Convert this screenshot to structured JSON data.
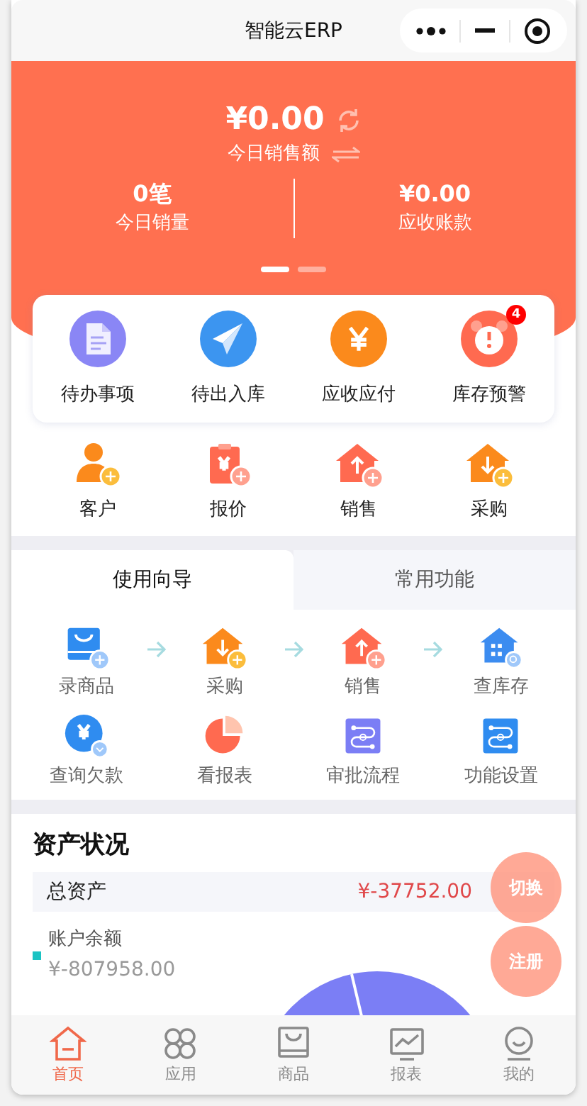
{
  "window": {
    "title": "智能云ERP"
  },
  "summary": {
    "amount": "¥0.00",
    "amount_label": "今日销售额",
    "stats": [
      {
        "value": "0笔",
        "label": "今日销量"
      },
      {
        "value": "¥0.00",
        "label": "应收账款"
      }
    ],
    "pages": [
      {
        "selected": true
      },
      {
        "selected": false
      }
    ]
  },
  "quick": [
    {
      "label": "待办事项",
      "kind": "document"
    },
    {
      "label": "待出入库",
      "kind": "paper-plane"
    },
    {
      "label": "应收应付",
      "kind": "yen-coin"
    },
    {
      "label": "库存预警",
      "kind": "alarm-clock",
      "badge": "4"
    }
  ],
  "shortcuts": [
    {
      "label": "客户",
      "kind": "person"
    },
    {
      "label": "报价",
      "kind": "clipboard"
    },
    {
      "label": "销售",
      "kind": "house-up"
    },
    {
      "label": "采购",
      "kind": "house-down"
    }
  ],
  "tabs": [
    {
      "label": "使用向导",
      "selected": true
    },
    {
      "label": "常用功能",
      "selected": false
    }
  ],
  "guide_steps": [
    {
      "label": "录商品",
      "kind": "bag"
    },
    {
      "label": "采购",
      "kind": "house-down"
    },
    {
      "label": "销售",
      "kind": "house-up"
    },
    {
      "label": "查库存",
      "kind": "building"
    }
  ],
  "guide_more": [
    {
      "label": "查询欠款",
      "kind": "yen-blue"
    },
    {
      "label": "看报表",
      "kind": "pie"
    },
    {
      "label": "审批流程",
      "kind": "flow"
    },
    {
      "label": "功能设置",
      "kind": "flow-blue"
    }
  ],
  "assets": {
    "title": "资产状况",
    "total_label": "总资产",
    "total_value": "¥-37752.00",
    "items": [
      {
        "label": "账户余额",
        "value": "¥-807958.00",
        "color": "#1bc3c3"
      }
    ]
  },
  "floating_buttons": [
    "切换",
    "注册"
  ],
  "nav": [
    {
      "label": "首页",
      "kind": "home",
      "selected": true
    },
    {
      "label": "应用",
      "kind": "apps",
      "selected": false
    },
    {
      "label": "商品",
      "kind": "goods",
      "selected": false
    },
    {
      "label": "报表",
      "kind": "chart",
      "selected": false
    },
    {
      "label": "我的",
      "kind": "face",
      "selected": false
    }
  ]
}
